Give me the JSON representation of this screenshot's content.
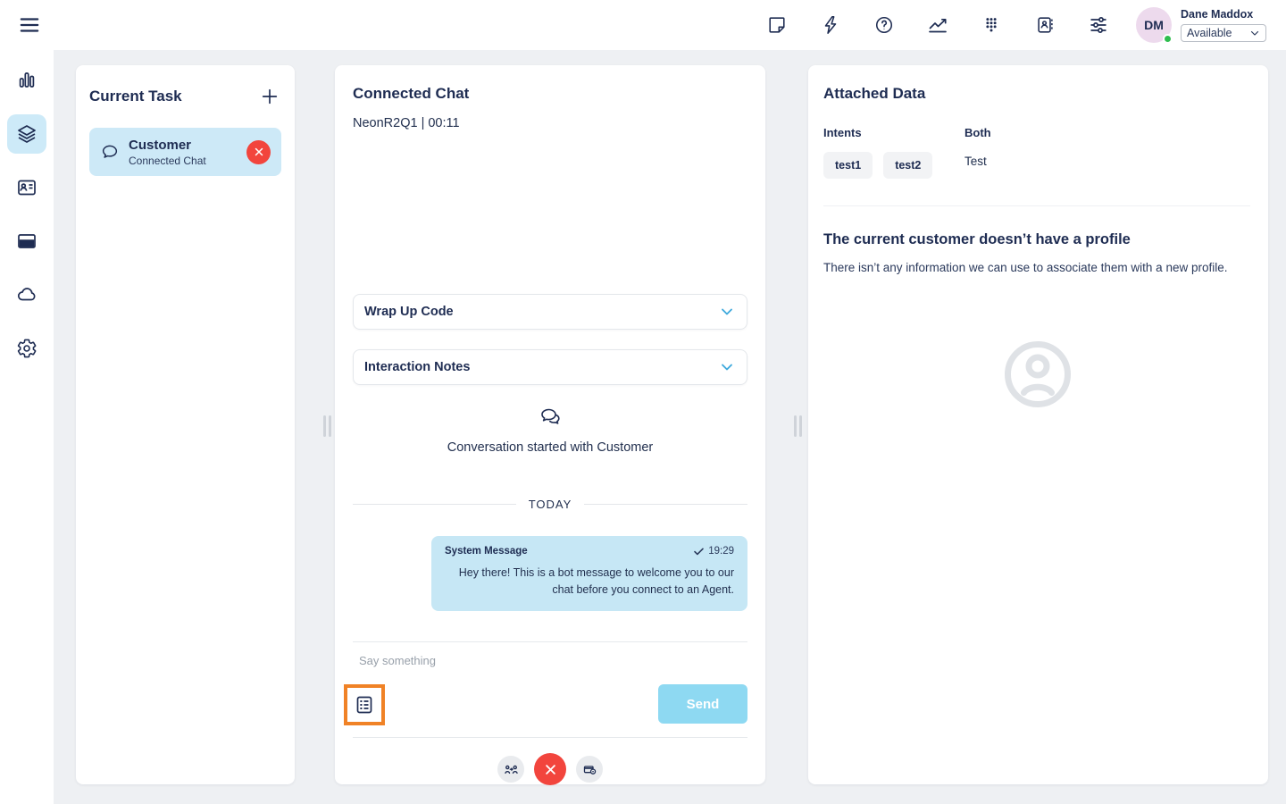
{
  "colors": {
    "navy": "#1e2c52",
    "selection_blue": "#cdeaf8",
    "bubble_blue": "#c6e7f5",
    "send_blue": "#8ed9f2",
    "alert_red": "#f2453d",
    "highlight_orange": "#f08226",
    "status_green": "#2fbd4f",
    "avatar_bg": "#eddaed"
  },
  "topbar": {
    "icons": [
      "notes",
      "quick-actions",
      "help",
      "analytics",
      "dialpad",
      "address-book",
      "filters"
    ],
    "user": {
      "initials": "DM",
      "name": "Dane Maddox",
      "status": "Available"
    }
  },
  "sidebar": {
    "items": [
      "metrics",
      "interactions",
      "contact-card",
      "apps-window",
      "cloud",
      "settings"
    ],
    "selected": "interactions"
  },
  "current_task": {
    "title": "Current Task",
    "task": {
      "name": "Customer",
      "type": "Connected Chat"
    }
  },
  "chat": {
    "title": "Connected Chat",
    "meta": "NeonR2Q1 | 00:11",
    "wrap_up_label": "Wrap Up Code",
    "notes_label": "Interaction Notes",
    "started_text": "Conversation started with Customer",
    "day_divider": "TODAY",
    "message": {
      "sender": "System Message",
      "time": "19:29",
      "text": "Hey there! This is a bot message to welcome you to our chat before you connect to an Agent."
    },
    "input_placeholder": "Say something",
    "send_label": "Send"
  },
  "attached_data": {
    "title": "Attached Data",
    "intents_label": "Intents",
    "intents": [
      "test1",
      "test2"
    ],
    "both_label": "Both",
    "both_value": "Test",
    "no_profile_title": "The current customer doesn’t have a profile",
    "no_profile_text": "There isn’t any information we can use to associate them with a new profile."
  }
}
